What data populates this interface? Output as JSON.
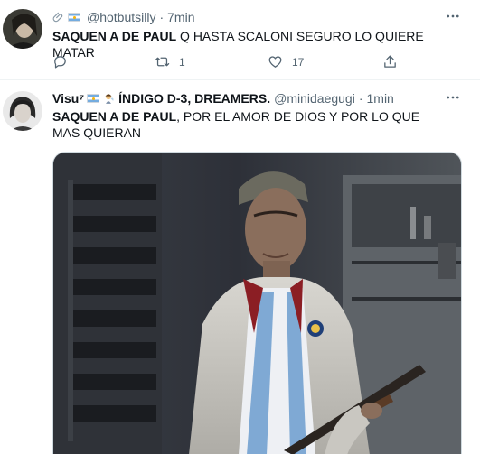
{
  "tweets": [
    {
      "author_name_prefix": "",
      "handle": "@hotbutsilly",
      "time": "7min",
      "text_bold": "SAQUEN A DE PAUL",
      "text_rest": " Q HASTA SCALONI SEGURO LO QUIERE MATAR",
      "actions": {
        "reply_count": "",
        "retweet_count": "1",
        "like_count": "17"
      }
    },
    {
      "author_name": "Visu⁷",
      "author_suffix": "ÍNDIGO D-3, DREAMERS.",
      "handle": "@minidaegugi",
      "time": "1min",
      "text_bold": "SAQUEN A DE PAUL",
      "text_rest": ", POR EL AMOR DE DIOS Y POR LO QUE MAS QUIERAN"
    }
  ],
  "icons": [
    "paperclip-icon",
    "argentina-flag-icon",
    "more-icon",
    "reply-icon",
    "retweet-icon",
    "like-icon",
    "share-icon",
    "fairy-emoji-icon"
  ],
  "colors": {
    "text": "#0f1419",
    "secondary": "#536471",
    "divider": "#eff3f4"
  }
}
